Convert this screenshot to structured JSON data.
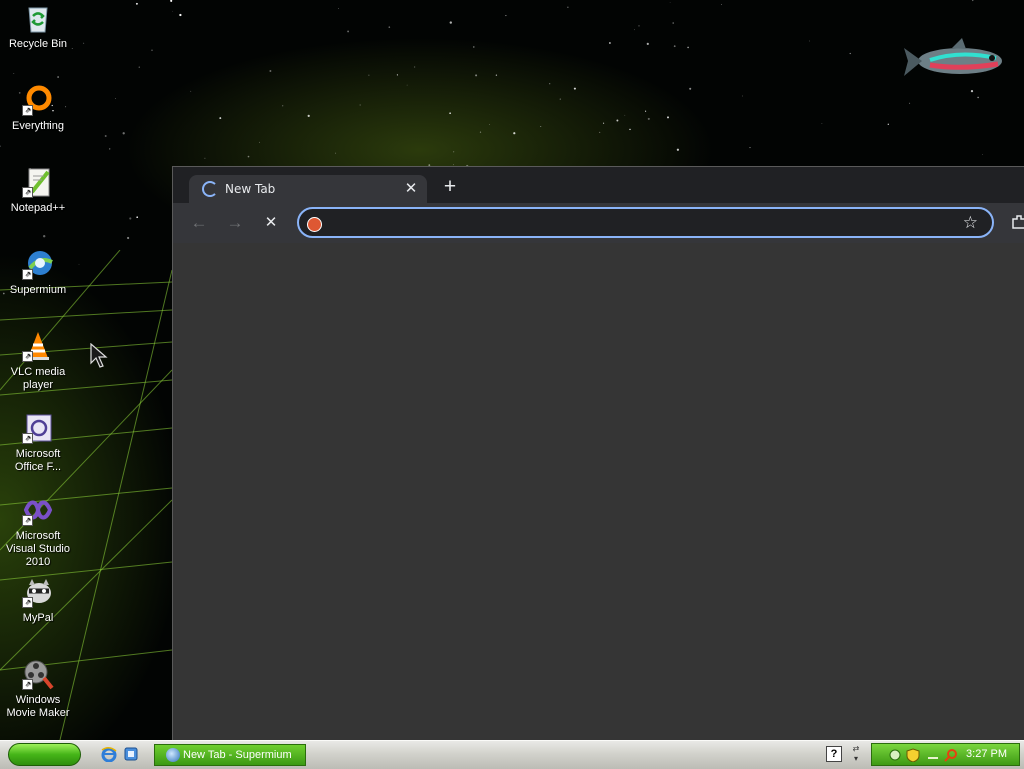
{
  "desktop": {
    "icons": [
      {
        "label": "Recycle Bin",
        "icon": "recycle-bin-icon"
      },
      {
        "label": "Everything",
        "icon": "everything-search-icon"
      },
      {
        "label": "Notepad++",
        "icon": "notepadpp-icon"
      },
      {
        "label": "Supermium",
        "icon": "supermium-icon"
      },
      {
        "label": "VLC media player",
        "icon": "vlc-cone-icon"
      },
      {
        "label": "Microsoft Office F...",
        "icon": "office-frontpage-icon"
      },
      {
        "label": "Microsoft Visual Studio 2010",
        "icon": "visual-studio-icon"
      },
      {
        "label": "MyPal",
        "icon": "mypal-raccoon-icon"
      },
      {
        "label": "Windows Movie Maker",
        "icon": "movie-maker-icon"
      }
    ]
  },
  "browser": {
    "tab": {
      "title": "New Tab",
      "close": "✕"
    },
    "new_tab": "+",
    "nav": {
      "back": "←",
      "forward": "→",
      "stop": "✕"
    },
    "omnibox": {
      "value": "",
      "placeholder": ""
    },
    "bookmark_star": "☆"
  },
  "taskbar": {
    "task_button_label": "New Tab - Supermium",
    "help_glyph": "?",
    "clock": "3:27 PM"
  },
  "colors": {
    "accent": "#8ab4f8",
    "browser_frame": "#202124",
    "browser_bg": "#353535",
    "taskbar_green": "#3e9a14"
  }
}
